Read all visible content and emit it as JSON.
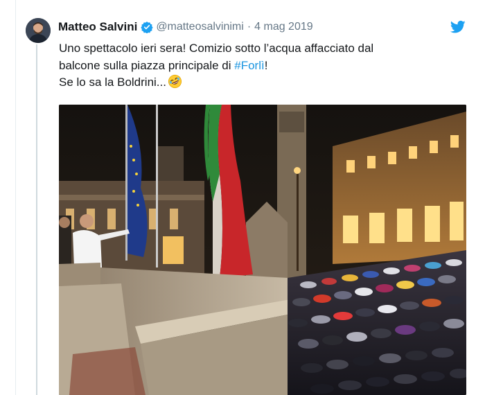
{
  "tweet": {
    "author": {
      "display_name": "Matteo Salvini",
      "handle": "@matteosalvinimi",
      "verified": true,
      "avatar_icon": "user-avatar"
    },
    "date": "4 mag 2019",
    "separator": "·",
    "text": {
      "line1": "Uno spettacolo ieri sera! Comizio sotto l’acqua affacciato dal",
      "line2_before": "balcone sulla piazza principale di ",
      "hashtag": "#Forlì",
      "line2_after": "!",
      "line3": "Se lo sa la Boldrini...",
      "emoji": "rolling-on-floor-laughing-emoji"
    },
    "media": {
      "type": "photo",
      "icon": "photo-night-rally-rain-umbrellas"
    },
    "platform_icon": "twitter-bird-icon"
  },
  "colors": {
    "accent": "#1da1f2",
    "hashtag": "#1b95e0",
    "muted": "#657786",
    "text": "#14171a",
    "thread_line": "#cfd9de"
  }
}
